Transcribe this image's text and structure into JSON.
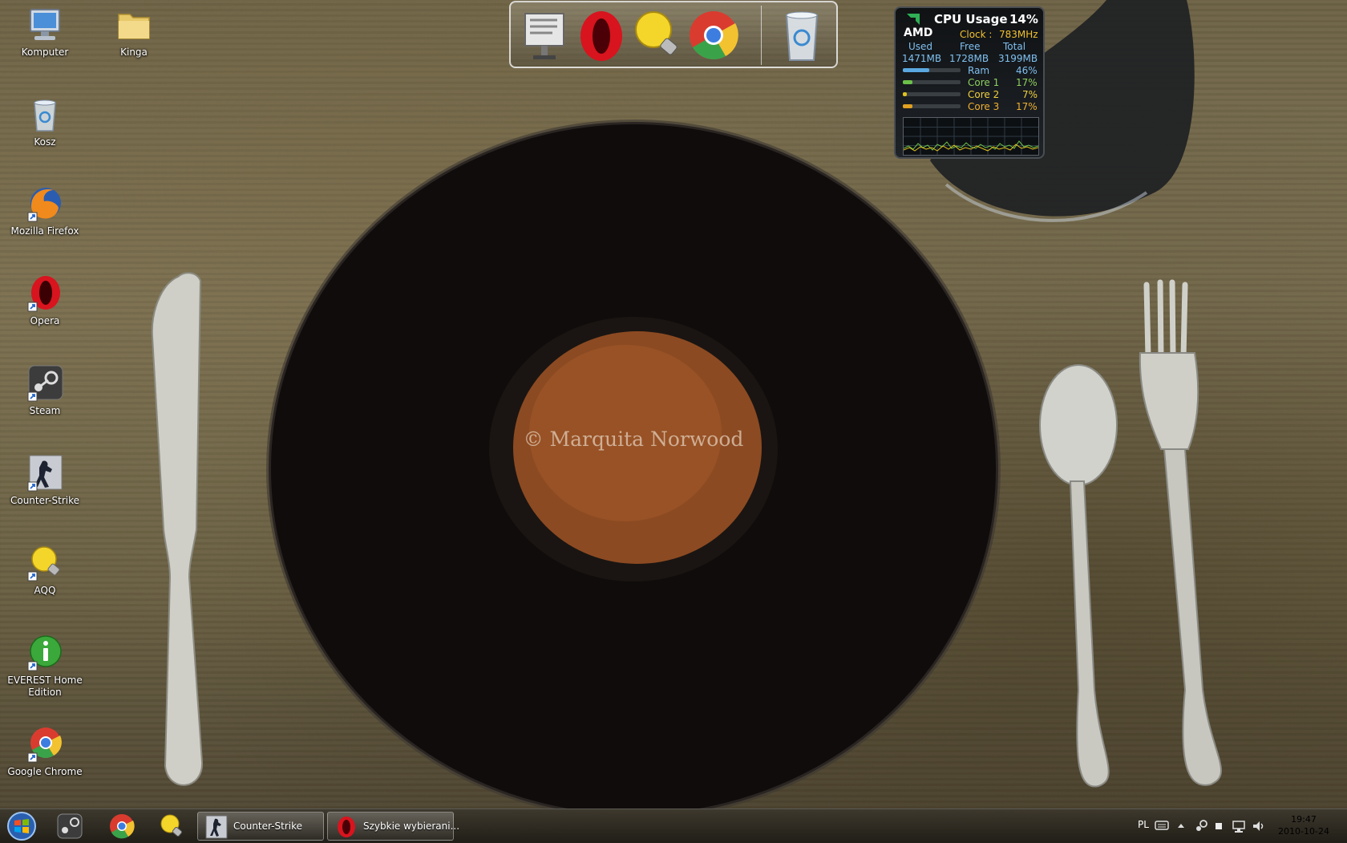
{
  "watermark": "© Marquita  Norwood",
  "desktop_icons": [
    {
      "label": "Komputer"
    },
    {
      "label": "Kinga"
    },
    {
      "label": "Kosz"
    },
    {
      "label": "Mozilla Firefox"
    },
    {
      "label": "Opera"
    },
    {
      "label": "Steam"
    },
    {
      "label": "Counter-Strike"
    },
    {
      "label": "AQQ"
    },
    {
      "label": "EVEREST Home Edition"
    },
    {
      "label": "Google Chrome"
    }
  ],
  "cpu_gadget": {
    "brand": "AMD",
    "title": "CPU Usage",
    "usage": "14%",
    "clock_label": "Clock :",
    "clock_value": "783MHz",
    "used_label": "Used",
    "free_label": "Free",
    "total_label": "Total",
    "used_value": "1471MB",
    "free_value": "1728MB",
    "total_value": "3199MB",
    "rows": [
      {
        "label": "Ram",
        "value": "46%",
        "fraction": 0.46,
        "color": "#5aa8e0"
      },
      {
        "label": "Core 1",
        "value": "17%",
        "fraction": 0.17,
        "color": "#6cc04a"
      },
      {
        "label": "Core 2",
        "value": "7%",
        "fraction": 0.07,
        "color": "#e0c020"
      },
      {
        "label": "Core 3",
        "value": "17%",
        "fraction": 0.17,
        "color": "#e0a020"
      }
    ]
  },
  "taskbar": {
    "tasks": [
      {
        "label": "Counter-Strike"
      },
      {
        "label": "Szybkie wybierani..."
      }
    ],
    "language": "PL",
    "time": "19:47",
    "date": "2010-10-24"
  },
  "colors": {
    "gadget_title": "#ffffff",
    "gadget_accent": "#f0c030",
    "gadget_value": "#7fc0f0"
  }
}
